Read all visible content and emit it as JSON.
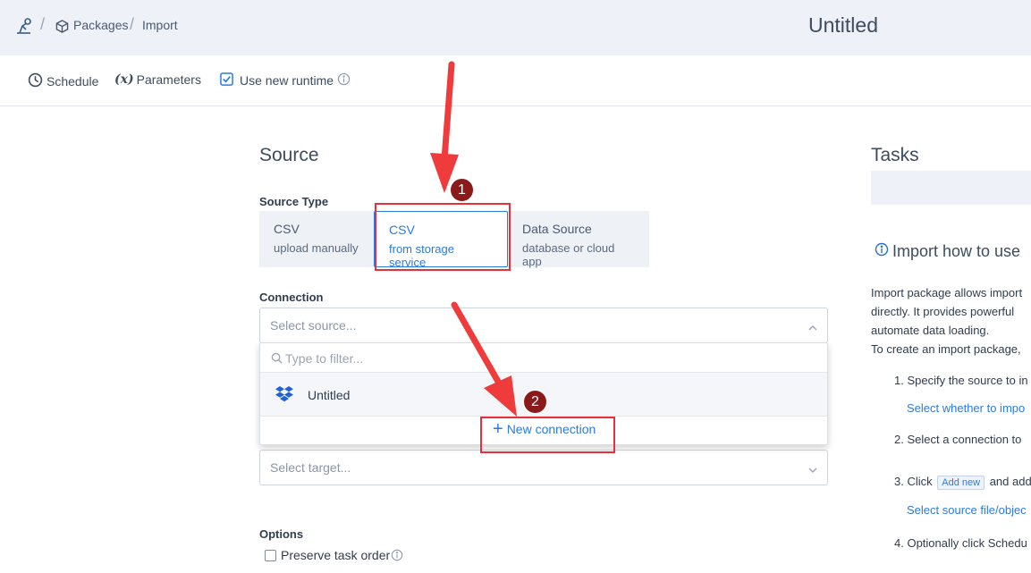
{
  "breadcrumb": {
    "packages": "Packages",
    "import": "Import"
  },
  "page_title": "Untitled",
  "toolbar": {
    "schedule": "Schedule",
    "parameters_prefix": "(x)",
    "parameters": "Parameters",
    "use_new_runtime": "Use new runtime"
  },
  "source": {
    "heading": "Source",
    "source_type_label": "Source Type",
    "types": [
      {
        "title": "CSV",
        "subtitle": "upload manually"
      },
      {
        "title": "CSV",
        "subtitle": "from storage service"
      },
      {
        "title": "Data Source",
        "subtitle": "database or cloud app"
      }
    ],
    "connection_label": "Connection",
    "connection_placeholder": "Select source...",
    "filter_placeholder": "Type to filter...",
    "connection_item": "Untitled",
    "new_connection": "New connection",
    "target_placeholder": "Select target...",
    "options_label": "Options",
    "preserve_task_order": "Preserve task order"
  },
  "tasks": {
    "heading": "Tasks"
  },
  "help": {
    "title": "Import how to use",
    "lines": [
      "Import package allows import",
      "directly. It provides powerful",
      "automate data loading.",
      "To create an import package,"
    ],
    "steps": [
      {
        "text": "1. Specify the source to in",
        "sub": "Select whether to impo"
      },
      {
        "text": "2. Select a connection to",
        "sub": ""
      },
      {
        "text_before": "3. Click",
        "badge": "Add new",
        "text_after": "and add",
        "sub": "Select source file/objec"
      },
      {
        "text": "4. Optionally click Schedu",
        "sub": ""
      }
    ]
  },
  "annotations": {
    "one": "1",
    "two": "2"
  },
  "colors": {
    "accent": "#2a7ae2",
    "annotation_red": "#e8303a",
    "annotation_badge": "#8b1a1a",
    "header_bg": "#eef1f7"
  }
}
